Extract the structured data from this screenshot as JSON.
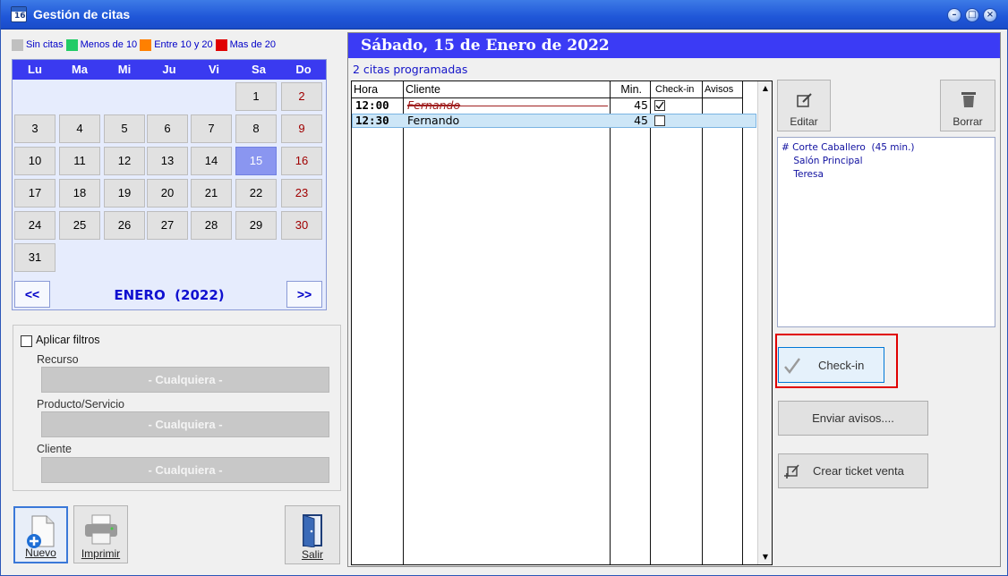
{
  "window": {
    "title": "Gestión de citas",
    "icon_text": "16"
  },
  "legend": [
    {
      "label": "Sin citas",
      "color": "#c0c0c0"
    },
    {
      "label": "Menos de 10",
      "color": "#22cc66"
    },
    {
      "label": "Entre 10 y 20",
      "color": "#ff8000"
    },
    {
      "label": "Mas de 20",
      "color": "#e00000"
    }
  ],
  "calendar": {
    "weekdays": [
      "Lu",
      "Ma",
      "Mi",
      "Ju",
      "Vi",
      "Sa",
      "Do"
    ],
    "month_label": "ENERO  (2022)",
    "prev_label": "<<",
    "next_label": ">>",
    "selected_day": "15",
    "weeks": [
      [
        "",
        "",
        "",
        "",
        "",
        "1",
        "2"
      ],
      [
        "3",
        "4",
        "5",
        "6",
        "7",
        "8",
        "9"
      ],
      [
        "10",
        "11",
        "12",
        "13",
        "14",
        "15",
        "16"
      ],
      [
        "17",
        "18",
        "19",
        "20",
        "21",
        "22",
        "23"
      ],
      [
        "24",
        "25",
        "26",
        "27",
        "28",
        "29",
        "30"
      ],
      [
        "31",
        "",
        "",
        "",
        "",
        "",
        ""
      ]
    ]
  },
  "filters": {
    "apply_label": "Aplicar filtros",
    "recurso_label": "Recurso",
    "recurso_value": "- Cualquiera -",
    "producto_label": "Producto/Servicio",
    "producto_value": "- Cualquiera -",
    "cliente_label": "Cliente",
    "cliente_value": "- Cualquiera -"
  },
  "buttons": {
    "nuevo": "Nuevo",
    "imprimir": "Imprimir",
    "salir": "Salir"
  },
  "day": {
    "header": "Sábado, 15 de Enero de 2022",
    "count": "2 citas programadas",
    "columns": [
      "Hora",
      "Cliente",
      "Min.",
      "Check-in",
      "Avisos"
    ],
    "rows": [
      {
        "hora": "12:00",
        "cliente": "Fernando",
        "min": "45",
        "checked": true,
        "cancelled": true
      },
      {
        "hora": "12:30",
        "cliente": "Fernando",
        "min": "45",
        "checked": false,
        "cancelled": false
      }
    ]
  },
  "actions": {
    "editar": "Editar",
    "borrar": "Borrar",
    "detail_lines": [
      "# Corte Caballero  (45 min.)",
      "    Salón Principal",
      "    Teresa"
    ],
    "checkin": "Check-in",
    "enviar": "Enviar avisos....",
    "ticket": "Crear ticket venta"
  },
  "colors": {
    "accent": "#3b3bf5",
    "highlight_border": "#e00000",
    "selected_row": "#cde6f7"
  }
}
